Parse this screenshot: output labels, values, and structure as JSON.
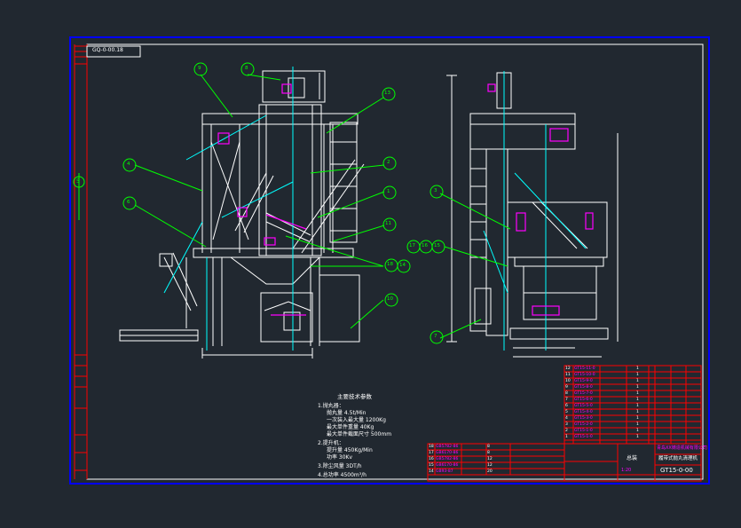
{
  "drawing": {
    "drawing_code_top": "GQ-0-00.18",
    "side_label": "5",
    "balloons": [
      "1",
      "2",
      "3",
      "4",
      "5",
      "6",
      "7",
      "8",
      "9",
      "10",
      "11",
      "13",
      "14",
      "15",
      "16",
      "17",
      "18"
    ],
    "notes": {
      "title": "主要技术参数",
      "item1_header": "1.抛丸器：",
      "item1_lines": [
        "抛丸量  4.5t/Min",
        "一次装入最大量  1200Kg",
        "最大单件重量  40Kg",
        "最大单件截面尺寸  500mm"
      ],
      "item2_header": "2.提升机：",
      "item2_lines": [
        "提升量  450Kg/Min",
        "功率  30Kv"
      ],
      "item3": "3.除尘风量  3DT/h",
      "item4": "4.总功率  4500m³/h"
    },
    "title_block": {
      "drawing_number": "GT15-0-00",
      "name": "履带式抛丸清理机",
      "company": "青岛XX铸造机械有限公司",
      "scale": "1:20",
      "material": "总装"
    },
    "bom_right": [
      {
        "no": "12",
        "code": "GT15-11-0",
        "qty": "1"
      },
      {
        "no": "11",
        "code": "GT15-10-0",
        "qty": "1"
      },
      {
        "no": "10",
        "code": "GT15-9-0",
        "qty": "1"
      },
      {
        "no": "9",
        "code": "GT15-8-0",
        "qty": "1"
      },
      {
        "no": "8",
        "code": "GT15-7-0",
        "qty": "1"
      },
      {
        "no": "7",
        "code": "GT15-6-0",
        "qty": "1"
      },
      {
        "no": "6",
        "code": "GT15-5-0",
        "qty": "1"
      },
      {
        "no": "5",
        "code": "GT15-4-0",
        "qty": "1"
      },
      {
        "no": "4",
        "code": "GT15-3-0",
        "qty": "1"
      },
      {
        "no": "3",
        "code": "GT15-2-0",
        "qty": "1"
      },
      {
        "no": "2",
        "code": "GT15-1-0",
        "qty": "1"
      },
      {
        "no": "1",
        "code": "GT15-1-0",
        "qty": "1"
      }
    ],
    "bom_left": [
      {
        "no": "18",
        "code": "GB5782-86",
        "qty": "8"
      },
      {
        "no": "17",
        "code": "GB6170-86",
        "qty": "8"
      },
      {
        "no": "16",
        "code": "GB5782-86",
        "qty": "12"
      },
      {
        "no": "15",
        "code": "GB6170-86",
        "qty": "12"
      },
      {
        "no": "14",
        "code": "GB93-87",
        "qty": "20"
      }
    ]
  },
  "colors": {
    "background": "#212830",
    "border": "#0000ff",
    "frame_left": "#ff0000",
    "geometry": "#ffffff",
    "centerline": "#00ffff",
    "leader": "#00ff00",
    "accent": "#ff00ff"
  }
}
